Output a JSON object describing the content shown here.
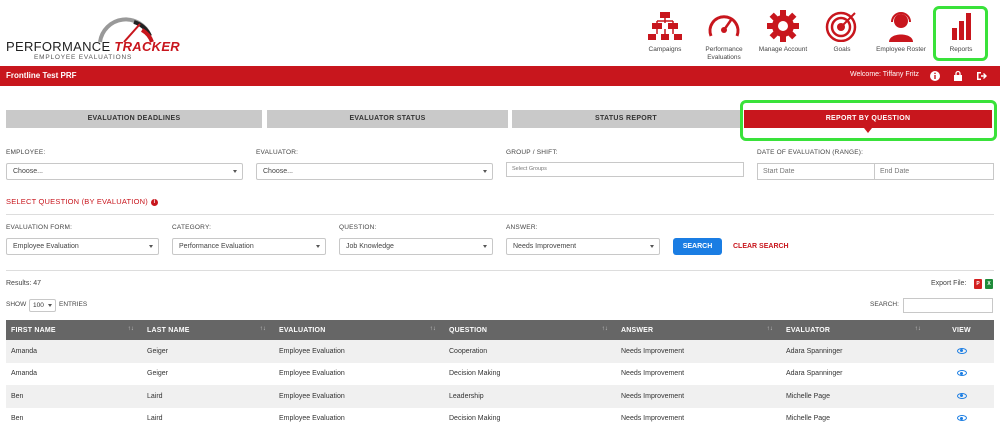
{
  "logo": {
    "word1": "PERFORMANCE",
    "word2": "TRACKER",
    "subtitle": "EMPLOYEE EVALUATIONS"
  },
  "nav": [
    {
      "label": "Campaigns",
      "icon": "org-chart-icon"
    },
    {
      "label": "Performance Evaluations",
      "icon": "speedometer-icon"
    },
    {
      "label": "Manage Account",
      "icon": "gear-icon"
    },
    {
      "label": "Goals",
      "icon": "target-icon"
    },
    {
      "label": "Employee Roster",
      "icon": "headset-user-icon"
    },
    {
      "label": "Reports",
      "icon": "bar-chart-icon"
    }
  ],
  "bar": {
    "page_name": "Frontline Test PRF",
    "welcome": "Welcome: Tiffany Fritz"
  },
  "tabs": [
    "EVALUATION DEADLINES",
    "EVALUATOR STATUS",
    "STATUS REPORT",
    "REPORT BY QUESTION"
  ],
  "filters": {
    "employee_label": "EMPLOYEE:",
    "employee_value": "Choose...",
    "evaluator_label": "EVALUATOR:",
    "evaluator_value": "Choose...",
    "group_label": "GROUP / SHIFT:",
    "group_placeholder": "Select Groups",
    "date_label": "DATE OF EVALUATION (RANGE):",
    "start_placeholder": "Start Date",
    "end_placeholder": "End Date"
  },
  "select_question": {
    "title": "SELECT QUESTION (BY EVALUATION)",
    "form_label": "EVALUATION FORM:",
    "form_value": "Employee Evaluation",
    "category_label": "CATEGORY:",
    "category_value": "Performance Evaluation",
    "question_label": "QUESTION:",
    "question_value": "Job Knowledge",
    "answer_label": "ANSWER:",
    "answer_value": "Needs Improvement",
    "search_button": "SEARCH",
    "clear_button": "CLEAR SEARCH"
  },
  "results": {
    "count_text": "Results: 47",
    "export_label": "Export File:",
    "show_label": "SHOW",
    "show_value": "100",
    "entries_label": "ENTRIES",
    "search_label": "SEARCH:"
  },
  "table": {
    "headers": [
      "FIRST NAME",
      "LAST NAME",
      "EVALUATION",
      "QUESTION",
      "ANSWER",
      "EVALUATOR",
      "VIEW"
    ],
    "rows": [
      [
        "Amanda",
        "Geiger",
        "Employee Evaluation",
        "Cooperation",
        "Needs Improvement",
        "Adara Spanninger"
      ],
      [
        "Amanda",
        "Geiger",
        "Employee Evaluation",
        "Decision Making",
        "Needs Improvement",
        "Adara Spanninger"
      ],
      [
        "Ben",
        "Laird",
        "Employee Evaluation",
        "Leadership",
        "Needs Improvement",
        "Michelle Page"
      ],
      [
        "Ben",
        "Laird",
        "Employee Evaluation",
        "Decision Making",
        "Needs Improvement",
        "Michelle Page"
      ]
    ]
  },
  "colors": {
    "brand_red": "#c8161d",
    "highlight_green": "#39e23a",
    "action_blue": "#1a7de3"
  }
}
